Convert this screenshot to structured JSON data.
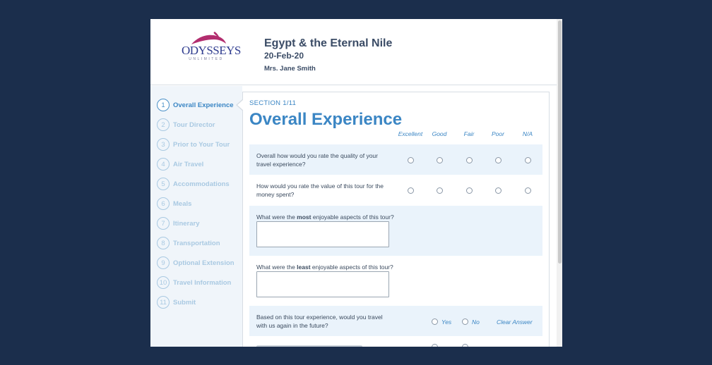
{
  "header": {
    "logo_text": "ODYSSEYS",
    "logo_sub": "UNLIMITED",
    "trip_title": "Egypt & the Eternal Nile",
    "trip_date": "20-Feb-20",
    "traveler": "Mrs. Jane Smith"
  },
  "sidebar": {
    "items": [
      {
        "num": "1",
        "label": "Overall Experience"
      },
      {
        "num": "2",
        "label": "Tour Director"
      },
      {
        "num": "3",
        "label": "Prior to Your Tour"
      },
      {
        "num": "4",
        "label": "Air Travel"
      },
      {
        "num": "5",
        "label": "Accommodations"
      },
      {
        "num": "6",
        "label": "Meals"
      },
      {
        "num": "7",
        "label": "Itinerary"
      },
      {
        "num": "8",
        "label": "Transportation"
      },
      {
        "num": "9",
        "label": "Optional Extension"
      },
      {
        "num": "10",
        "label": "Travel Information"
      },
      {
        "num": "11",
        "label": "Submit"
      }
    ]
  },
  "section": {
    "number": "SECTION 1/11",
    "title": "Overall Experience",
    "columns": [
      "Excellent",
      "Good",
      "Fair",
      "Poor",
      "N/A"
    ]
  },
  "questions": {
    "q1": "Overall how would you rate the quality of your travel experience?",
    "q2": "How would you rate the value of this tour for the money spent?",
    "q3_pre": "What were the ",
    "q3_bold": "most",
    "q3_post": " enjoyable aspects of this tour?",
    "q4_pre": "What were the ",
    "q4_bold": "least",
    "q4_post": " enjoyable aspects of this tour?",
    "q5": "Based on this tour experience, would you travel with us again in the future?",
    "q5_yes": "Yes",
    "q5_no": "No",
    "q5_clear": "Clear Answer"
  }
}
